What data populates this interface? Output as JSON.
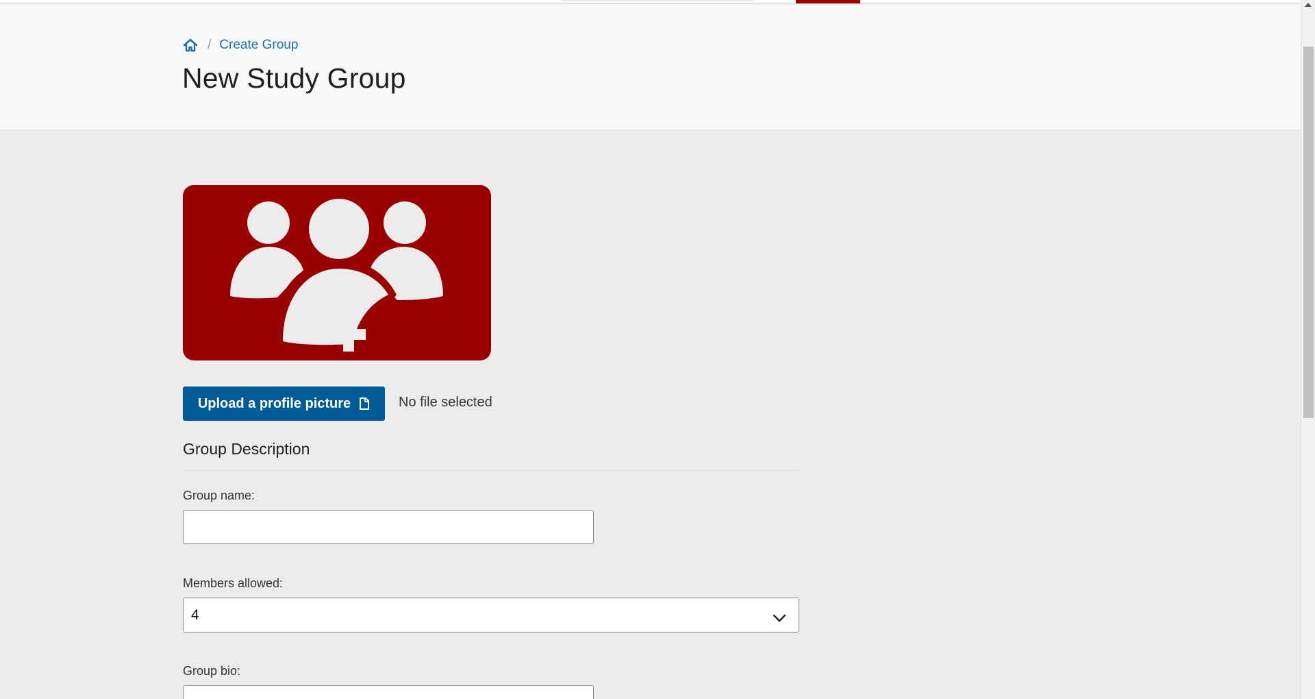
{
  "breadcrumb": {
    "home_icon": "home-icon",
    "separator": "/",
    "current": "Create Group"
  },
  "page": {
    "title": "New Study Group"
  },
  "avatar": {
    "icon": "group-add-icon",
    "background_color": "#990000"
  },
  "upload": {
    "button_label": "Upload a profile picture",
    "button_icon": "file-icon",
    "status": "No file selected"
  },
  "form": {
    "section_title": "Group Description",
    "group_name": {
      "label": "Group name:",
      "value": ""
    },
    "members_allowed": {
      "label": "Members allowed:",
      "selected": "4"
    },
    "group_bio": {
      "label": "Group bio:",
      "value": ""
    }
  },
  "colors": {
    "brand_red": "#990000",
    "button_blue": "#005b94",
    "link_blue": "#1f6fa8"
  }
}
